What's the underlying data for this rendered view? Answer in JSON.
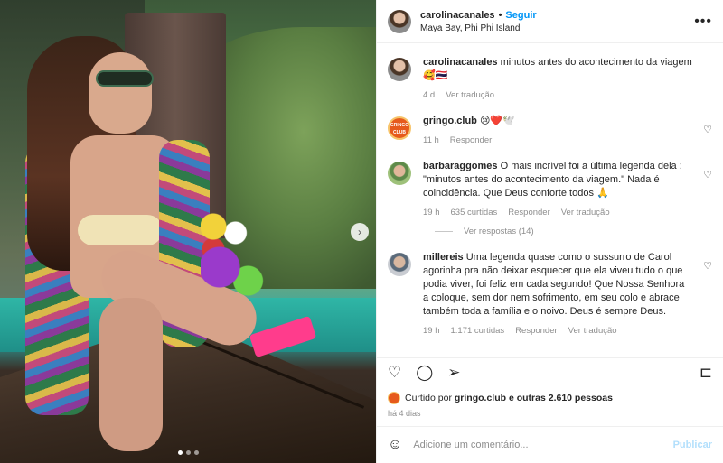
{
  "post": {
    "username": "carolinacanales",
    "separator": "•",
    "follow_label": "Seguir",
    "location": "Maya Bay, Phi Phi Island",
    "more_glyph": "•••",
    "carousel_next_glyph": "›"
  },
  "caption": {
    "username": "carolinacanales",
    "text": "minutos antes do acontecimento da viagem",
    "emojis": "🥰🇹🇭",
    "age": "4 d",
    "translate": "Ver tradução"
  },
  "comments": [
    {
      "username": "gringo.club",
      "avatar_text": "GRINGO CLUB",
      "text": "😢❤️🕊️",
      "age": "11 h",
      "likes": "",
      "reply": "Responder",
      "translate": ""
    },
    {
      "username": "barbaraggomes",
      "avatar_text": "",
      "text": "O mais incrível foi a última legenda dela : \"minutos antes do acontecimento da viagem.\" Nada é coincidência. Que Deus conforte todos 🙏",
      "age": "19 h",
      "likes": "635 curtidas",
      "reply": "Responder",
      "translate": "Ver tradução",
      "replies": "Ver respostas (14)"
    },
    {
      "username": "millereis",
      "avatar_text": "",
      "text": "Uma legenda quase como o sussurro de Carol agorinha pra não deixar esquecer que ela viveu tudo o que podia viver, foi feliz em cada segundo! Que Nossa Senhora a coloque, sem dor nem sofrimento, em seu colo e abrace também toda a família e o noivo. Deus é sempre Deus.",
      "age": "19 h",
      "likes": "1.171 curtidas",
      "reply": "Responder",
      "translate": "Ver tradução"
    }
  ],
  "icons": {
    "heart": "♡",
    "comment": "◯",
    "share": "➢",
    "bookmark": "⊏",
    "emoji": "☺"
  },
  "likes_line": {
    "prefix": "Curtido por",
    "user": "gringo.club",
    "suffix": "e outras 2.610 pessoas"
  },
  "posted_time": "há 4 dias",
  "add_comment": {
    "placeholder": "Adicione um comentário...",
    "publish_label": "Publicar"
  },
  "carousel": {
    "count": 3,
    "active": 1
  }
}
